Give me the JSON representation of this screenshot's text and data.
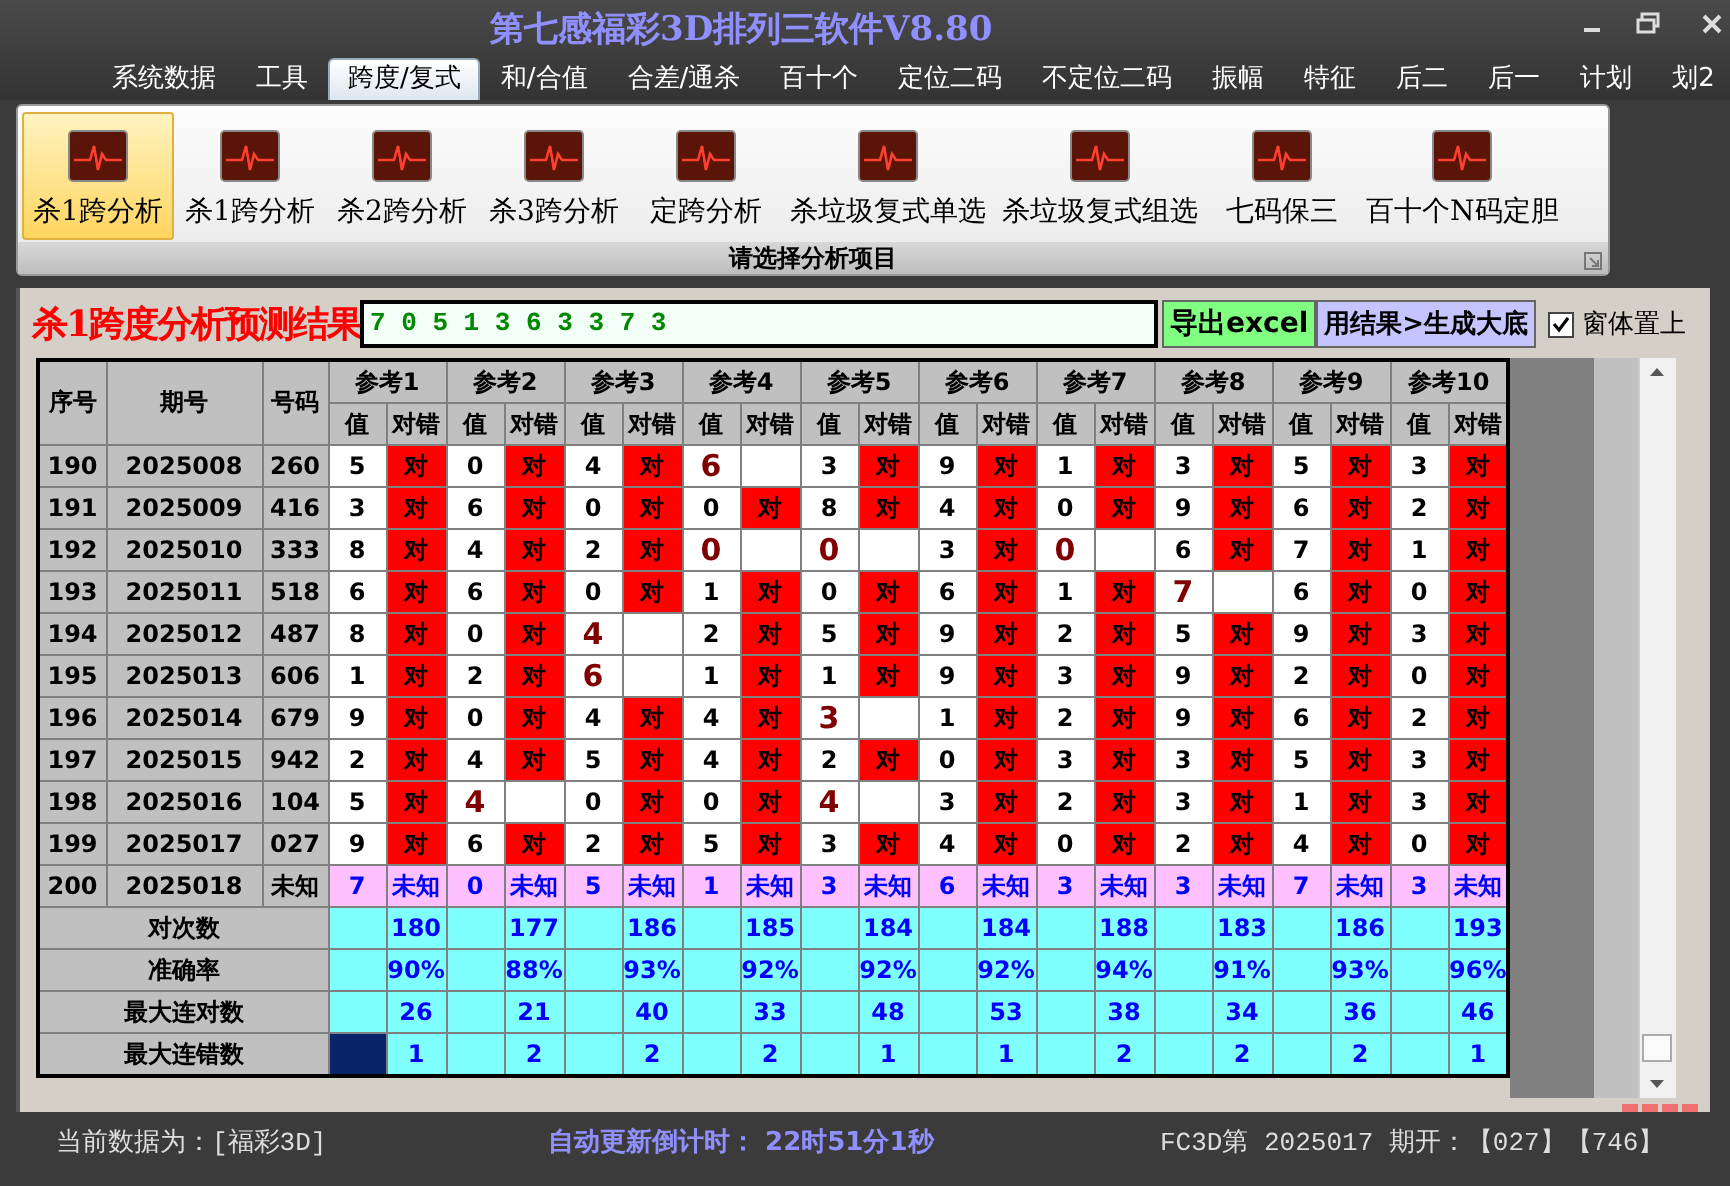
{
  "window": {
    "title": "第七感福彩3D排列三软件V8.80"
  },
  "menu_tabs": [
    {
      "label": "系统数据",
      "selected": false
    },
    {
      "label": "工具",
      "selected": false
    },
    {
      "label": "跨度/复式",
      "selected": true
    },
    {
      "label": "和/合值",
      "selected": false
    },
    {
      "label": "合差/通杀",
      "selected": false
    },
    {
      "label": "百十个",
      "selected": false
    },
    {
      "label": "定位二码",
      "selected": false
    },
    {
      "label": "不定位二码",
      "selected": false
    },
    {
      "label": "振幅",
      "selected": false
    },
    {
      "label": "特征",
      "selected": false
    },
    {
      "label": "后二",
      "selected": false
    },
    {
      "label": "后一",
      "selected": false
    },
    {
      "label": "计划",
      "selected": false
    },
    {
      "label": "划2",
      "selected": false
    }
  ],
  "ribbon": {
    "buttons": [
      {
        "label": "杀1跨分析",
        "selected": true
      },
      {
        "label": "杀1跨分析",
        "selected": false
      },
      {
        "label": "杀2跨分析",
        "selected": false
      },
      {
        "label": "杀3跨分析",
        "selected": false
      },
      {
        "label": "定跨分析",
        "selected": false
      },
      {
        "label": "杀垃圾复式单选",
        "selected": false
      },
      {
        "label": "杀垃圾复式组选",
        "selected": false
      },
      {
        "label": "七码保三",
        "selected": false
      },
      {
        "label": "百十个N码定胆",
        "selected": false
      }
    ],
    "group_label": "请选择分析项目"
  },
  "result": {
    "title": "杀1跨度分析预测结果",
    "numbers": "7 0 5 1 3 6 3 3 7 3",
    "export_button": "导出excel",
    "generate_button": "用结果>生成大底",
    "checkbox": {
      "label": "窗体置上",
      "checked": true
    }
  },
  "table": {
    "columns": [
      "序号",
      "期号",
      "号码"
    ],
    "refs": [
      {
        "label": "参考1",
        "value_label": "值",
        "hit_label": "对错"
      },
      {
        "label": "参考2",
        "value_label": "值",
        "hit_label": "对错"
      },
      {
        "label": "参考3",
        "value_label": "值",
        "hit_label": "对错"
      },
      {
        "label": "参考4",
        "value_label": "值",
        "hit_label": "对错"
      },
      {
        "label": "参考5",
        "value_label": "值",
        "hit_label": "对错"
      },
      {
        "label": "参考6",
        "value_label": "值",
        "hit_label": "对错"
      },
      {
        "label": "参考7",
        "value_label": "值",
        "hit_label": "对错"
      },
      {
        "label": "参考8",
        "value_label": "值",
        "hit_label": "对错"
      },
      {
        "label": "参考9",
        "value_label": "值",
        "hit_label": "对错"
      },
      {
        "label": "参考10",
        "value_label": "值",
        "hit_label": "对错"
      }
    ],
    "rows": [
      {
        "kind": "history",
        "index": "190",
        "period": "2025008",
        "number": "260",
        "cells": [
          {
            "value": "5",
            "hit": true,
            "mark": "对"
          },
          {
            "value": "0",
            "hit": true,
            "mark": "对"
          },
          {
            "value": "4",
            "hit": true,
            "mark": "对"
          },
          {
            "value": "6",
            "hit": false
          },
          {
            "value": "3",
            "hit": true,
            "mark": "对"
          },
          {
            "value": "9",
            "hit": true,
            "mark": "对"
          },
          {
            "value": "1",
            "hit": true,
            "mark": "对"
          },
          {
            "value": "3",
            "hit": true,
            "mark": "对"
          },
          {
            "value": "5",
            "hit": true,
            "mark": "对"
          },
          {
            "value": "3",
            "hit": true,
            "mark": "对"
          }
        ]
      },
      {
        "kind": "history",
        "index": "191",
        "period": "2025009",
        "number": "416",
        "cells": [
          {
            "value": "3",
            "hit": true,
            "mark": "对"
          },
          {
            "value": "6",
            "hit": true,
            "mark": "对"
          },
          {
            "value": "0",
            "hit": true,
            "mark": "对"
          },
          {
            "value": "0",
            "hit": true,
            "mark": "对"
          },
          {
            "value": "8",
            "hit": true,
            "mark": "对"
          },
          {
            "value": "4",
            "hit": true,
            "mark": "对"
          },
          {
            "value": "0",
            "hit": true,
            "mark": "对"
          },
          {
            "value": "9",
            "hit": true,
            "mark": "对"
          },
          {
            "value": "6",
            "hit": true,
            "mark": "对"
          },
          {
            "value": "2",
            "hit": true,
            "mark": "对"
          }
        ]
      },
      {
        "kind": "history",
        "index": "192",
        "period": "2025010",
        "number": "333",
        "cells": [
          {
            "value": "8",
            "hit": true,
            "mark": "对"
          },
          {
            "value": "4",
            "hit": true,
            "mark": "对"
          },
          {
            "value": "2",
            "hit": true,
            "mark": "对"
          },
          {
            "value": "0",
            "hit": false
          },
          {
            "value": "0",
            "hit": false
          },
          {
            "value": "3",
            "hit": true,
            "mark": "对"
          },
          {
            "value": "0",
            "hit": false
          },
          {
            "value": "6",
            "hit": true,
            "mark": "对"
          },
          {
            "value": "7",
            "hit": true,
            "mark": "对"
          },
          {
            "value": "1",
            "hit": true,
            "mark": "对"
          }
        ]
      },
      {
        "kind": "history",
        "index": "193",
        "period": "2025011",
        "number": "518",
        "cells": [
          {
            "value": "6",
            "hit": true,
            "mark": "对"
          },
          {
            "value": "6",
            "hit": true,
            "mark": "对"
          },
          {
            "value": "0",
            "hit": true,
            "mark": "对"
          },
          {
            "value": "1",
            "hit": true,
            "mark": "对"
          },
          {
            "value": "0",
            "hit": true,
            "mark": "对"
          },
          {
            "value": "6",
            "hit": true,
            "mark": "对"
          },
          {
            "value": "1",
            "hit": true,
            "mark": "对"
          },
          {
            "value": "7",
            "hit": false
          },
          {
            "value": "6",
            "hit": true,
            "mark": "对"
          },
          {
            "value": "0",
            "hit": true,
            "mark": "对"
          }
        ]
      },
      {
        "kind": "history",
        "index": "194",
        "period": "2025012",
        "number": "487",
        "cells": [
          {
            "value": "8",
            "hit": true,
            "mark": "对"
          },
          {
            "value": "0",
            "hit": true,
            "mark": "对"
          },
          {
            "value": "4",
            "hit": false
          },
          {
            "value": "2",
            "hit": true,
            "mark": "对"
          },
          {
            "value": "5",
            "hit": true,
            "mark": "对"
          },
          {
            "value": "9",
            "hit": true,
            "mark": "对"
          },
          {
            "value": "2",
            "hit": true,
            "mark": "对"
          },
          {
            "value": "5",
            "hit": true,
            "mark": "对"
          },
          {
            "value": "9",
            "hit": true,
            "mark": "对"
          },
          {
            "value": "3",
            "hit": true,
            "mark": "对"
          }
        ]
      },
      {
        "kind": "history",
        "index": "195",
        "period": "2025013",
        "number": "606",
        "cells": [
          {
            "value": "1",
            "hit": true,
            "mark": "对"
          },
          {
            "value": "2",
            "hit": true,
            "mark": "对"
          },
          {
            "value": "6",
            "hit": false
          },
          {
            "value": "1",
            "hit": true,
            "mark": "对"
          },
          {
            "value": "1",
            "hit": true,
            "mark": "对"
          },
          {
            "value": "9",
            "hit": true,
            "mark": "对"
          },
          {
            "value": "3",
            "hit": true,
            "mark": "对"
          },
          {
            "value": "9",
            "hit": true,
            "mark": "对"
          },
          {
            "value": "2",
            "hit": true,
            "mark": "对"
          },
          {
            "value": "0",
            "hit": true,
            "mark": "对"
          }
        ]
      },
      {
        "kind": "history",
        "index": "196",
        "period": "2025014",
        "number": "679",
        "cells": [
          {
            "value": "9",
            "hit": true,
            "mark": "对"
          },
          {
            "value": "0",
            "hit": true,
            "mark": "对"
          },
          {
            "value": "4",
            "hit": true,
            "mark": "对"
          },
          {
            "value": "4",
            "hit": true,
            "mark": "对"
          },
          {
            "value": "3",
            "hit": false
          },
          {
            "value": "1",
            "hit": true,
            "mark": "对"
          },
          {
            "value": "2",
            "hit": true,
            "mark": "对"
          },
          {
            "value": "9",
            "hit": true,
            "mark": "对"
          },
          {
            "value": "6",
            "hit": true,
            "mark": "对"
          },
          {
            "value": "2",
            "hit": true,
            "mark": "对"
          }
        ]
      },
      {
        "kind": "history",
        "index": "197",
        "period": "2025015",
        "number": "942",
        "cells": [
          {
            "value": "2",
            "hit": true,
            "mark": "对"
          },
          {
            "value": "4",
            "hit": true,
            "mark": "对"
          },
          {
            "value": "5",
            "hit": true,
            "mark": "对"
          },
          {
            "value": "4",
            "hit": true,
            "mark": "对"
          },
          {
            "value": "2",
            "hit": true,
            "mark": "对"
          },
          {
            "value": "0",
            "hit": true,
            "mark": "对"
          },
          {
            "value": "3",
            "hit": true,
            "mark": "对"
          },
          {
            "value": "3",
            "hit": true,
            "mark": "对"
          },
          {
            "value": "5",
            "hit": true,
            "mark": "对"
          },
          {
            "value": "3",
            "hit": true,
            "mark": "对"
          }
        ]
      },
      {
        "kind": "history",
        "index": "198",
        "period": "2025016",
        "number": "104",
        "cells": [
          {
            "value": "5",
            "hit": true,
            "mark": "对"
          },
          {
            "value": "4",
            "hit": false
          },
          {
            "value": "0",
            "hit": true,
            "mark": "对"
          },
          {
            "value": "0",
            "hit": true,
            "mark": "对"
          },
          {
            "value": "4",
            "hit": false
          },
          {
            "value": "3",
            "hit": true,
            "mark": "对"
          },
          {
            "value": "2",
            "hit": true,
            "mark": "对"
          },
          {
            "value": "3",
            "hit": true,
            "mark": "对"
          },
          {
            "value": "1",
            "hit": true,
            "mark": "对"
          },
          {
            "value": "3",
            "hit": true,
            "mark": "对"
          }
        ]
      },
      {
        "kind": "history",
        "index": "199",
        "period": "2025017",
        "number": "027",
        "cells": [
          {
            "value": "9",
            "hit": true,
            "mark": "对"
          },
          {
            "value": "6",
            "hit": true,
            "mark": "对"
          },
          {
            "value": "2",
            "hit": true,
            "mark": "对"
          },
          {
            "value": "5",
            "hit": true,
            "mark": "对"
          },
          {
            "value": "3",
            "hit": true,
            "mark": "对"
          },
          {
            "value": "4",
            "hit": true,
            "mark": "对"
          },
          {
            "value": "0",
            "hit": true,
            "mark": "对"
          },
          {
            "value": "2",
            "hit": true,
            "mark": "对"
          },
          {
            "value": "4",
            "hit": true,
            "mark": "对"
          },
          {
            "value": "0",
            "hit": true,
            "mark": "对"
          }
        ]
      },
      {
        "kind": "pending",
        "index": "200",
        "period": "2025018",
        "number": "未知",
        "cells": [
          {
            "value": "7",
            "mark": "未知"
          },
          {
            "value": "0",
            "mark": "未知"
          },
          {
            "value": "5",
            "mark": "未知"
          },
          {
            "value": "1",
            "mark": "未知"
          },
          {
            "value": "3",
            "mark": "未知"
          },
          {
            "value": "6",
            "mark": "未知"
          },
          {
            "value": "3",
            "mark": "未知"
          },
          {
            "value": "3",
            "mark": "未知"
          },
          {
            "value": "7",
            "mark": "未知"
          },
          {
            "value": "3",
            "mark": "未知"
          }
        ]
      }
    ],
    "stats": [
      {
        "label": "对次数",
        "selected": false,
        "values": [
          "180",
          "177",
          "186",
          "185",
          "184",
          "184",
          "188",
          "183",
          "186",
          "193"
        ]
      },
      {
        "label": "准确率",
        "selected": false,
        "values": [
          "90%",
          "88%",
          "93%",
          "92%",
          "92%",
          "92%",
          "94%",
          "91%",
          "93%",
          "96%"
        ]
      },
      {
        "label": "最大连对数",
        "selected": false,
        "values": [
          "26",
          "21",
          "40",
          "33",
          "48",
          "53",
          "38",
          "34",
          "36",
          "46"
        ]
      },
      {
        "label": "最大连错数",
        "selected": true,
        "values": [
          "1",
          "2",
          "2",
          "2",
          "1",
          "1",
          "2",
          "2",
          "2",
          "1"
        ]
      }
    ]
  },
  "status_bar": {
    "data_source": "当前数据为：[福彩3D]",
    "countdown": "自动更新倒计时： 22时51分1秒",
    "latest": "FC3D第 2025017 期开：【027】【746】"
  }
}
